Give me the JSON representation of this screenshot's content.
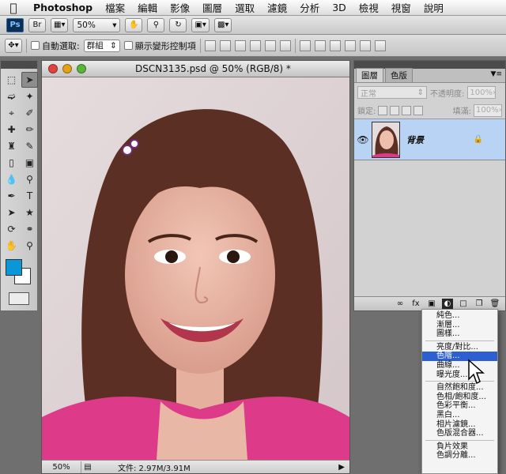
{
  "menubar": {
    "app": "Photoshop",
    "items": [
      "檔案",
      "編輯",
      "影像",
      "圖層",
      "選取",
      "濾鏡",
      "分析",
      "3D",
      "檢視",
      "視窗",
      "說明"
    ]
  },
  "appbar": {
    "logo": "Ps",
    "bridge": "Br",
    "zoom": "50%"
  },
  "options": {
    "auto_select_label": "自動選取:",
    "auto_select_value": "群組",
    "show_transform_label": "顯示變形控制項"
  },
  "document": {
    "title": "DSCN3135.psd @ 50% (RGB/8) *",
    "status_zoom": "50%",
    "status_doc": "文件: 2.97M/3.91M"
  },
  "layers_panel": {
    "tabs": [
      "圖層",
      "色版"
    ],
    "blend_mode": "正常",
    "opacity_label": "不透明度:",
    "opacity_value": "100%",
    "lock_label": "鎖定:",
    "fill_label": "填滿:",
    "fill_value": "100%",
    "layer_name": "背景"
  },
  "adjust_menu": {
    "group1": [
      "純色...",
      "漸層...",
      "圖樣..."
    ],
    "group2": [
      "亮度/對比...",
      "色階...",
      "曲線...",
      "曝光度..."
    ],
    "group3": [
      "自然飽和度...",
      "色相/飽和度...",
      "色彩平衡...",
      "黑白...",
      "相片濾鏡...",
      "色版混合器..."
    ],
    "group4": [
      "負片效果",
      "色調分離..."
    ],
    "highlighted": "色階..."
  },
  "colors": {
    "foreground": "#0a97d8",
    "background": "#ffffff",
    "highlight": "#2d5fd0",
    "layer_selected": "#b8d3f3"
  }
}
